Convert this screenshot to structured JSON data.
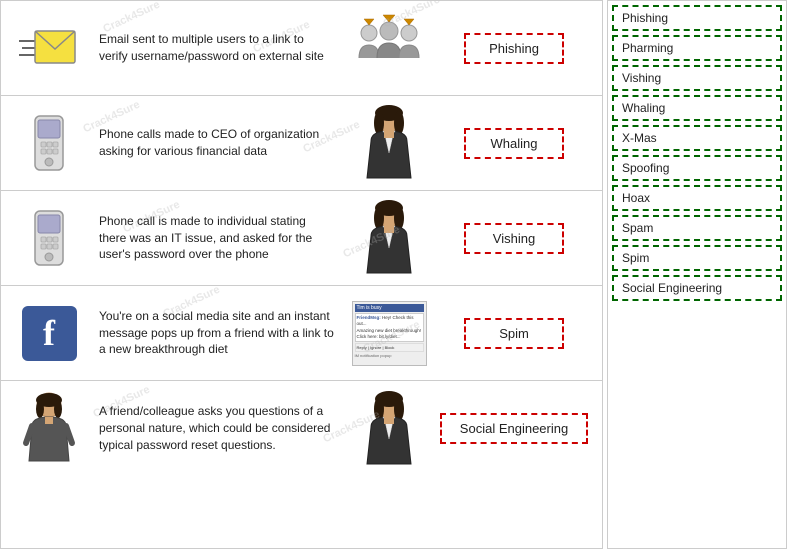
{
  "rows": [
    {
      "id": "row-phishing",
      "description": "Email sent to multiple users to a link to verify username/password on external site",
      "answer": "Phishing",
      "icon_type": "email",
      "person_type": "group"
    },
    {
      "id": "row-whaling",
      "description": "Phone calls made to CEO of organization asking for various financial data",
      "answer": "Whaling",
      "icon_type": "phone",
      "person_type": "female-exec"
    },
    {
      "id": "row-vishing",
      "description": "Phone call is made to individual stating there was an IT issue, and asked for the user's password over the phone",
      "answer": "Vishing",
      "icon_type": "phone",
      "person_type": "female"
    },
    {
      "id": "row-spim",
      "description": "You're on a social media site and an instant message pops up from a friend with a link to a new breakthrough diet",
      "answer": "Spim",
      "icon_type": "facebook",
      "person_type": "chat"
    },
    {
      "id": "row-social-engineering",
      "description": "A friend/colleague asks you questions of a personal nature, which could be considered typical password reset questions.",
      "answer": "Social Engineering",
      "icon_type": "person",
      "person_type": "female"
    }
  ],
  "sidebar": {
    "items": [
      {
        "label": "Phishing"
      },
      {
        "label": "Pharming"
      },
      {
        "label": "Vishing"
      },
      {
        "label": "Whaling"
      },
      {
        "label": "X-Mas"
      },
      {
        "label": "Spoofing"
      },
      {
        "label": "Hoax"
      },
      {
        "label": "Spam"
      },
      {
        "label": "Spim"
      },
      {
        "label": "Social Engineering"
      }
    ]
  },
  "watermark_text": "Crack4Sure"
}
